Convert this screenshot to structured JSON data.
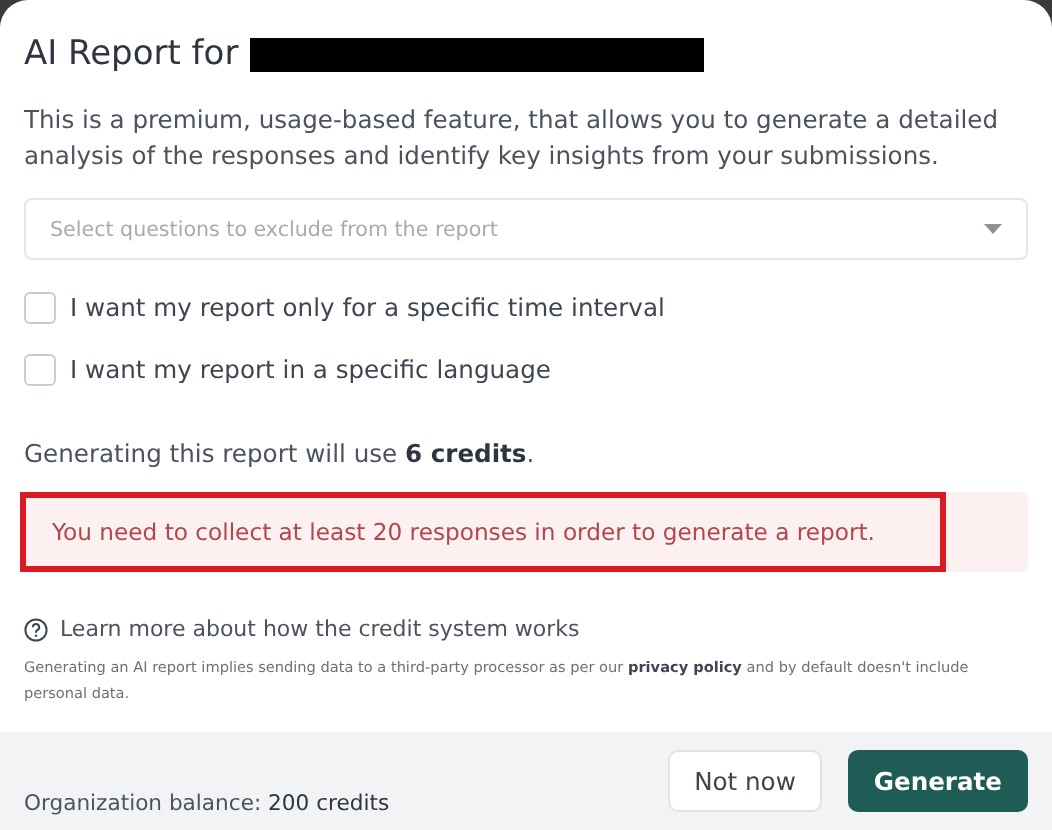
{
  "dialog": {
    "title": "AI Report for",
    "title_redacted": true,
    "description": "This is a premium, usage-based feature, that allows you to generate a detailed analysis of the responses and identify key insights from your submissions.",
    "question_select": {
      "placeholder": "Select questions to exclude from the report"
    },
    "options": [
      {
        "label": "I want my report only for a specific time interval",
        "checked": false
      },
      {
        "label": "I want my report in a specific language",
        "checked": false
      }
    ],
    "credits_note": "Generating this report will use **6 credits**.",
    "error": {
      "text": "You need to collect at least 20 responses in order to generate a report.",
      "highlighted": true
    },
    "help_link": "Learn more about how the credit system works",
    "disclaimer": {
      "before": "Generating an AI report implies sending data to a third-party processor as per our",
      "link": "privacy policy",
      "after": "and by default doesn't include personal data."
    },
    "footer": {
      "balance": "Organization balance: **200 credits**",
      "buttons": [
        {
          "label": "Not now",
          "kind": "secondary"
        },
        {
          "label": "Generate",
          "kind": "primary"
        }
      ]
    }
  }
}
